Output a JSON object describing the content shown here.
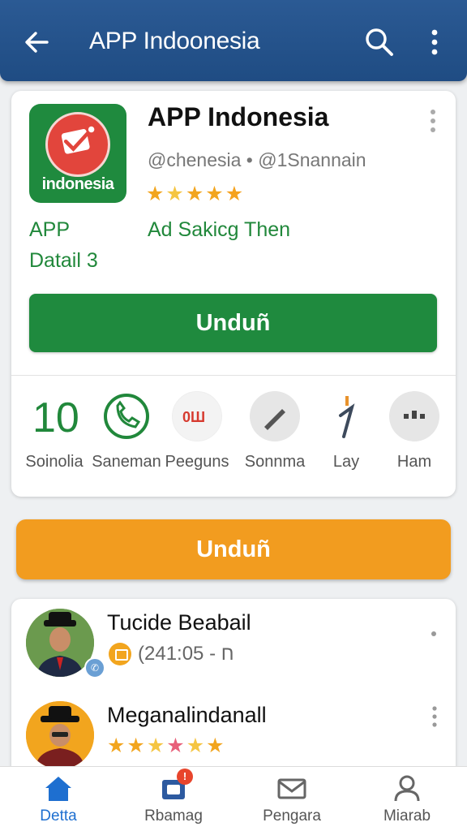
{
  "header": {
    "title": "APP Indoonesia",
    "back_icon": "arrow-left-icon",
    "search_icon": "search-icon",
    "menu_icon": "more-vert-icon",
    "bg_color": "#1f4c83"
  },
  "app": {
    "logo_text": "indonesia",
    "title": "APP Indonesia",
    "developer": "@chenesia • @1Snannain",
    "rating_stars": 4.5,
    "left_label_line1": "APP",
    "left_label_line2": "Datail 3",
    "right_label": "Ad Sakicg   Then",
    "install_label": "Unduñ",
    "accent_green": "#1f8a3e"
  },
  "categories": [
    {
      "label": "Soinolia",
      "icon": "number-10-icon"
    },
    {
      "label": "Saneman",
      "icon": "phone-icon"
    },
    {
      "label": "Peeguns",
      "icon": "grid-icon"
    },
    {
      "label": "Sonnma",
      "icon": "pen-icon"
    },
    {
      "label": "Lay",
      "icon": "pin-icon"
    },
    {
      "label": "Ham",
      "icon": "chart-icon"
    }
  ],
  "secondary_button": {
    "label": "Unduñ",
    "color": "#f29c1f"
  },
  "people": [
    {
      "name": "Tucide Beabail",
      "meta": "(24ח - 1:05"
    },
    {
      "name": "Meganalindanall",
      "rating_stars": 4.5
    }
  ],
  "bottom_nav": [
    {
      "label": "Detta",
      "icon": "home-icon",
      "active": true
    },
    {
      "label": "Rbamag",
      "icon": "inbox-icon",
      "badge": "!"
    },
    {
      "label": "Pengara",
      "icon": "mail-icon"
    },
    {
      "label": "Miarab",
      "icon": "person-icon"
    }
  ]
}
